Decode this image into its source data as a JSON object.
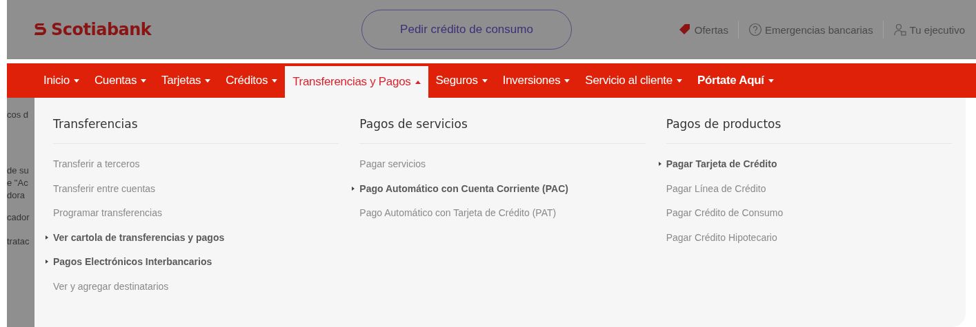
{
  "header": {
    "logo": "Scotiabank",
    "cta": "Pedir crédito de consumo",
    "links": [
      {
        "kind": "tag",
        "label": "Ofertas"
      },
      {
        "kind": "help",
        "label": "Emergencias bancarias"
      },
      {
        "kind": "person",
        "label": "Tu ejecutivo"
      }
    ]
  },
  "nav": [
    {
      "label": "Inicio",
      "selected": false,
      "emphasized": false
    },
    {
      "label": "Cuentas",
      "selected": false,
      "emphasized": false
    },
    {
      "label": "Tarjetas",
      "selected": false,
      "emphasized": false
    },
    {
      "label": "Créditos",
      "selected": false,
      "emphasized": false
    },
    {
      "label": "Transferencias y Pagos",
      "selected": true,
      "emphasized": false
    },
    {
      "label": "Seguros",
      "selected": false,
      "emphasized": false
    },
    {
      "label": "Inversiones",
      "selected": false,
      "emphasized": false
    },
    {
      "label": "Servicio al cliente",
      "selected": false,
      "emphasized": false
    },
    {
      "label": "Pórtate Aquí",
      "selected": false,
      "emphasized": true
    }
  ],
  "background_fragments": [
    "cos d",
    "de su",
    "e \"Ac",
    "dora",
    "cador",
    "tratac"
  ],
  "menu": [
    {
      "heading": "Transferencias",
      "items": [
        {
          "label": "Transferir a terceros",
          "featured": false
        },
        {
          "label": "Transferir entre cuentas",
          "featured": false
        },
        {
          "label": "Programar transferencias",
          "featured": false
        },
        {
          "label": "Ver cartola de transferencias y pagos",
          "featured": true
        },
        {
          "label": "Pagos Electrónicos Interbancarios",
          "featured": true
        },
        {
          "label": "Ver y agregar destinatarios",
          "featured": false
        }
      ]
    },
    {
      "heading": "Pagos de servicios",
      "items": [
        {
          "label": "Pagar servicios",
          "featured": false
        },
        {
          "label": "Pago Automático con Cuenta Corriente (PAC)",
          "featured": true
        },
        {
          "label": "Pago Automático con Tarjeta de Crédito (PAT)",
          "featured": false
        }
      ]
    },
    {
      "heading": "Pagos de productos",
      "items": [
        {
          "label": "Pagar Tarjeta de Crédito",
          "featured": true
        },
        {
          "label": "Pagar Línea de Crédito",
          "featured": false
        },
        {
          "label": "Pagar Crédito de Consumo",
          "featured": false
        },
        {
          "label": "Pagar Crédito Hipotecario",
          "featured": false
        }
      ]
    }
  ]
}
